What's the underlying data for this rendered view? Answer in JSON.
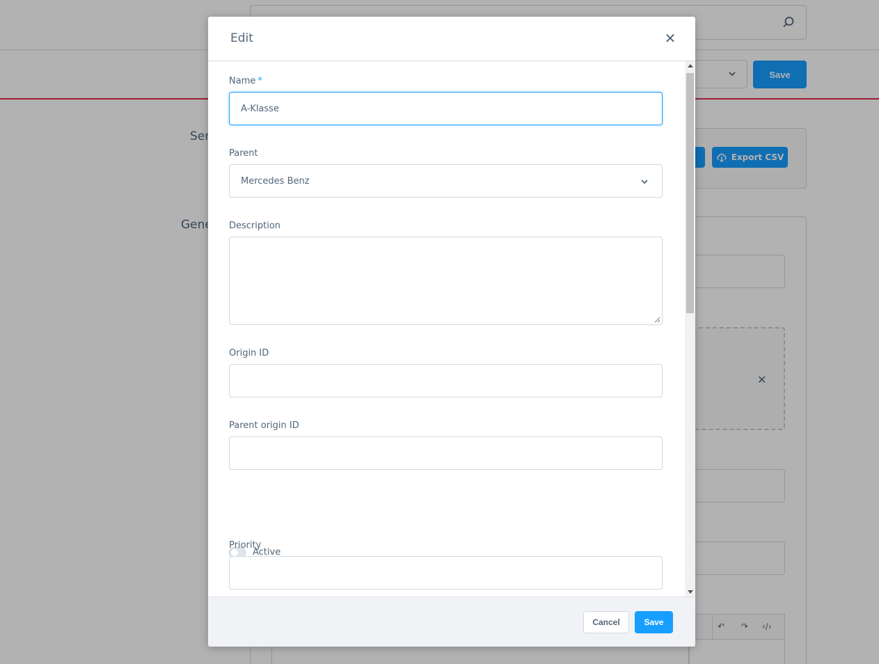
{
  "background": {
    "heading_1": "Ser",
    "heading_2": "Gene",
    "save_label": "Save",
    "export_label": "Export CSV"
  },
  "modal": {
    "title": "Edit",
    "close_icon": "close-icon",
    "fields": {
      "name": {
        "label": "Name",
        "required_mark": "*",
        "value": "A-Klasse"
      },
      "parent": {
        "label": "Parent",
        "value": "Mercedes Benz"
      },
      "description": {
        "label": "Description",
        "value": ""
      },
      "origin_id": {
        "label": "Origin ID",
        "value": ""
      },
      "parent_origin_id": {
        "label": "Parent origin ID",
        "value": ""
      },
      "active": {
        "label": "Active",
        "checked": false
      },
      "priority": {
        "label": "Priority",
        "value": ""
      }
    },
    "footer": {
      "cancel_label": "Cancel",
      "save_label": "Save"
    }
  },
  "colors": {
    "accent": "#189eff",
    "text": "#52667a",
    "border": "#d1d9e0",
    "danger_line": "#de294c"
  }
}
